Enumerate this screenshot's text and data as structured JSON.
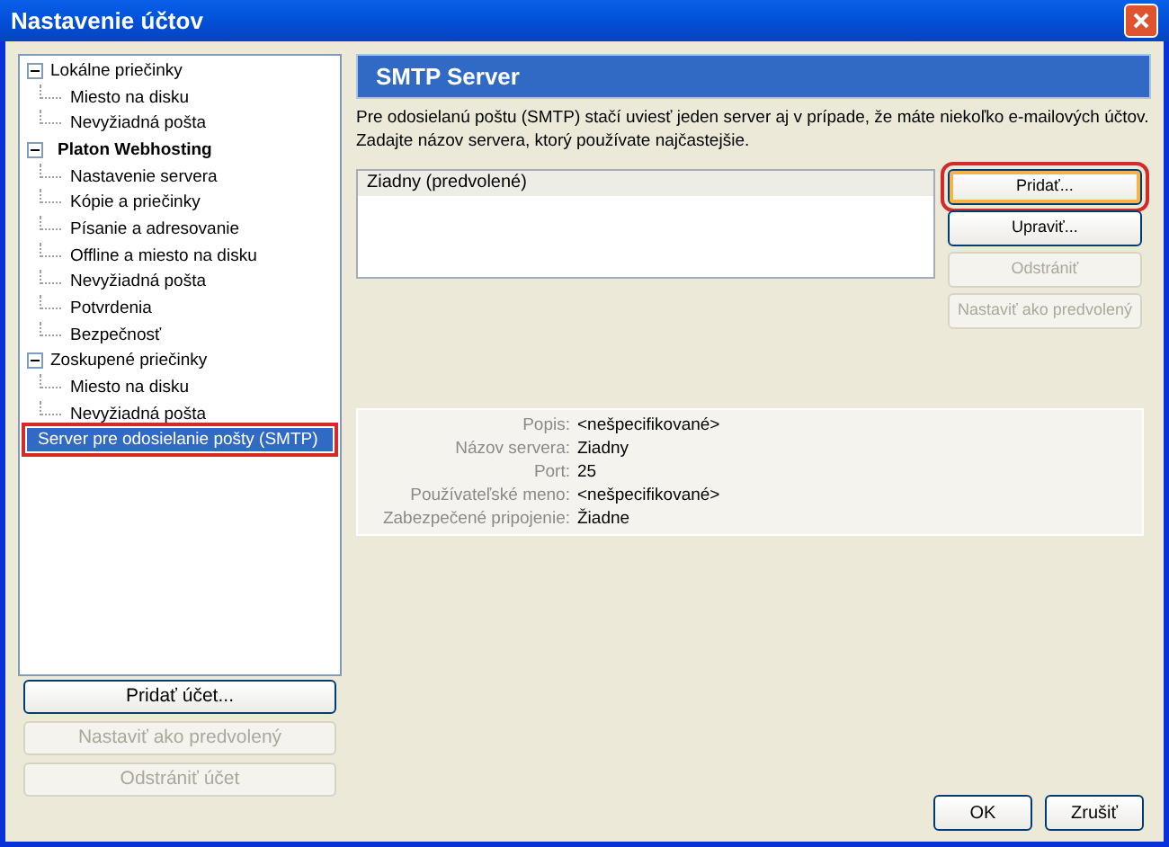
{
  "window": {
    "title": "Nastavenie účtov"
  },
  "tree": [
    {
      "label": "Lokálne priečinky",
      "kind": "folder",
      "expanded": true,
      "selected": false,
      "highlighted": false,
      "children": [
        {
          "label": "Miesto na disku",
          "selected": false,
          "highlighted": false
        },
        {
          "label": "Nevyžiadná pošta",
          "selected": false,
          "highlighted": false
        }
      ]
    },
    {
      "label": "Platon Webhosting",
      "kind": "account",
      "expanded": true,
      "selected": false,
      "highlighted": false,
      "children": [
        {
          "label": "Nastavenie servera",
          "selected": false,
          "highlighted": false
        },
        {
          "label": "Kópie a priečinky",
          "selected": false,
          "highlighted": false
        },
        {
          "label": "Písanie a adresovanie",
          "selected": false,
          "highlighted": false
        },
        {
          "label": "Offline a miesto na disku",
          "selected": false,
          "highlighted": false
        },
        {
          "label": "Nevyžiadná pošta",
          "selected": false,
          "highlighted": false
        },
        {
          "label": "Potvrdenia",
          "selected": false,
          "highlighted": false
        },
        {
          "label": "Bezpečnosť",
          "selected": false,
          "highlighted": false
        }
      ]
    },
    {
      "label": "Zoskupené priečinky",
      "kind": "folder",
      "expanded": true,
      "selected": false,
      "highlighted": false,
      "children": [
        {
          "label": "Miesto na disku",
          "selected": false,
          "highlighted": false
        },
        {
          "label": "Nevyžiadná pošta",
          "selected": false,
          "highlighted": false
        }
      ]
    },
    {
      "label": "Server pre odosielanie pošty (SMTP)",
      "kind": "leaf",
      "selected": true,
      "highlighted": true
    }
  ],
  "account_buttons": [
    {
      "label": "Pridať účet...",
      "disabled": false
    },
    {
      "label": "Nastaviť ako predvolený",
      "disabled": true
    },
    {
      "label": "Odstrániť účet",
      "disabled": true
    }
  ],
  "panel": {
    "title": "SMTP Server",
    "description": "Pre odosielanú poštu (SMTP) stačí uviesť jeden server aj v prípade, že máte niekoľko e-mailových účtov. Zadajte názov servera, ktorý používate najčastejšie.",
    "servers": [
      {
        "label": "Ziadny (predvolené)",
        "selected": false
      }
    ],
    "buttons": [
      {
        "label": "Pridať...",
        "disabled": false,
        "highlighted": true,
        "focused": true
      },
      {
        "label": "Upraviť...",
        "disabled": false,
        "highlighted": false,
        "focused": false
      },
      {
        "label": "Odstrániť",
        "disabled": true,
        "highlighted": false,
        "focused": false
      },
      {
        "label": "Nastaviť ako predvolený",
        "disabled": true,
        "highlighted": false,
        "focused": false
      }
    ],
    "details": [
      {
        "label": "Popis:",
        "value": "<nešpecifikované>"
      },
      {
        "label": "Názov servera:",
        "value": "Ziadny"
      },
      {
        "label": "Port:",
        "value": "25"
      },
      {
        "label": "Používateľské meno:",
        "value": "<nešpecifikované>"
      },
      {
        "label": "Zabezpečené pripojenie:",
        "value": "Žiadne"
      }
    ]
  },
  "dialog_buttons": [
    {
      "label": "OK"
    },
    {
      "label": "Zrušiť"
    }
  ]
}
